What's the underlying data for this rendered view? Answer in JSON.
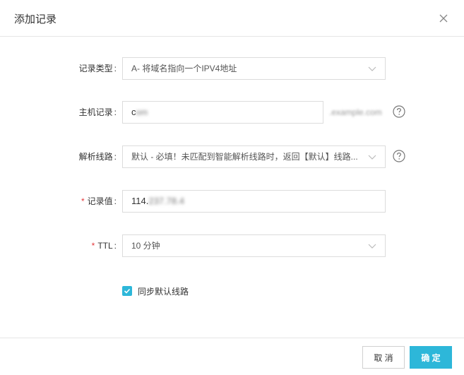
{
  "dialog": {
    "title": "添加记录",
    "close_icon": "close-icon"
  },
  "form": {
    "record_type": {
      "label": "记录类型",
      "value": "A- 将域名指向一个IPV4地址"
    },
    "host": {
      "label": "主机记录",
      "value": "c",
      "suffix": ".example.com"
    },
    "line": {
      "label": "解析线路",
      "value": "默认 - 必填！未匹配到智能解析线路时，返回【默认】线路..."
    },
    "record_value": {
      "label": "记录值",
      "value_visible": "114.",
      "value_blurred": "237.78.4"
    },
    "ttl": {
      "label": "TTL",
      "value": "10 分钟"
    },
    "sync": {
      "label": "同步默认线路",
      "checked": true
    }
  },
  "footer": {
    "cancel_label": "取 消",
    "ok_label": "确 定"
  },
  "colors": {
    "accent": "#2db7d9",
    "required": "#e4393c",
    "border": "#dcdcdc"
  }
}
